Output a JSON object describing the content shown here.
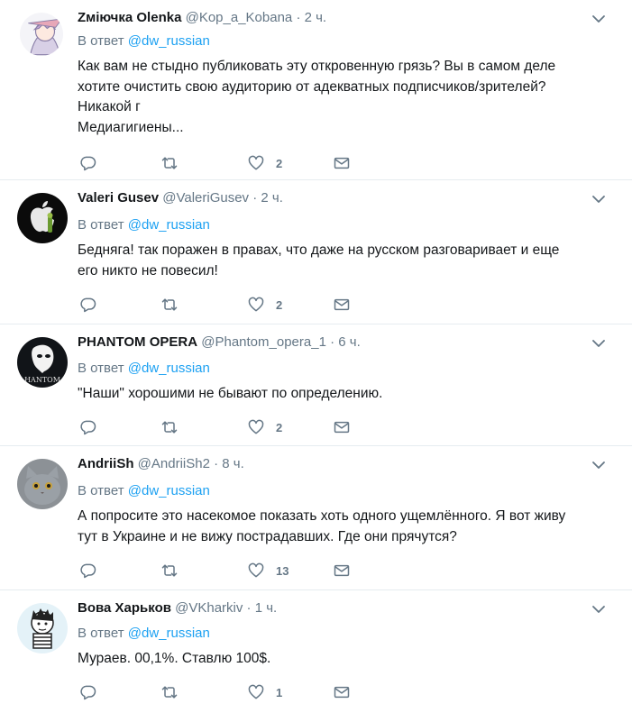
{
  "tweets": [
    {
      "name": "Zміючка Olenka",
      "handle": "@Kop_a_Kobana",
      "sep": "·",
      "time": "2 ч.",
      "reply_prefix": "В ответ",
      "reply_to": "@dw_russian",
      "lines": [
        "Как вам не стыдно публиковать эту откровенную грязь? Вы в самом деле",
        "хотите очистить свою аудиторию от адекватных подписчиков/зрителей?",
        "Никакой г",
        "Медиагигиены..."
      ],
      "likes": "2",
      "avatar_icon": "anime-drawing-avatar"
    },
    {
      "name": "Valeri Gusev",
      "handle": "@ValeriGusev",
      "sep": "·",
      "time": "2 ч.",
      "reply_prefix": "В ответ",
      "reply_to": "@dw_russian",
      "lines": [
        "Бедняга! так поражен в правах, что даже на русском разговаривает и еще",
        "его никто не повесил!"
      ],
      "likes": "2",
      "avatar_icon": "apple-logo-avatar"
    },
    {
      "name": "PHANTOM OPERA",
      "handle": "@Phantom_opera_1",
      "sep": "·",
      "time": "6 ч.",
      "reply_prefix": "В ответ",
      "reply_to": "@dw_russian",
      "lines": [
        "\"Наши\" хорошими не бывают по определению."
      ],
      "likes": "2",
      "avatar_icon": "phantom-mask-avatar",
      "avatar_text": "HANTOM"
    },
    {
      "name": "AndriiSh",
      "handle": "@AndriiSh2",
      "sep": "·",
      "time": "8 ч.",
      "reply_prefix": "В ответ",
      "reply_to": "@dw_russian",
      "lines": [
        "А попросите это насекомое показать хоть одного ущемлённого. Я вот живу",
        "тут в Украине и не вижу пострадавших. Где они прячутся?"
      ],
      "likes": "13",
      "avatar_icon": "grey-cat-avatar"
    },
    {
      "name": "Вова Харьков",
      "handle": "@VKharkiv",
      "sep": "·",
      "time": "1 ч.",
      "reply_prefix": "В ответ",
      "reply_to": "@dw_russian",
      "lines": [
        "Мураев. 00,1%. Ставлю 100$."
      ],
      "likes": "1",
      "avatar_icon": "cartoon-boy-avatar"
    }
  ],
  "colors": {
    "link": "#1da1f2",
    "secondary": "#657786",
    "text": "#14171a",
    "border": "#e6ecf0"
  }
}
